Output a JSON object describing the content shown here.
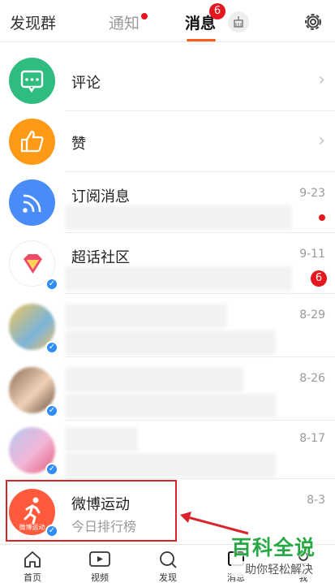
{
  "header": {
    "left_label": "发现群",
    "tab_notify": "通知",
    "tab_messages": "消息",
    "messages_badge": "6"
  },
  "rows": [
    {
      "title": "评论",
      "icon": "comment-icon",
      "color": "#2fbd7f"
    },
    {
      "title": "赞",
      "icon": "thumbs-up-icon",
      "color": "#ff9a16"
    },
    {
      "title": "订阅消息",
      "date": "9-23",
      "icon": "rss-icon",
      "color": "#4a8cf7"
    },
    {
      "title": "超话社区",
      "date": "9-11",
      "badge": "6",
      "icon": "diamond-icon"
    },
    {
      "date": "8-29"
    },
    {
      "date": "8-26"
    },
    {
      "date": "8-17"
    },
    {
      "title": "微博运动",
      "subtitle": "今日排行榜",
      "date": "8-3",
      "avatar_text": "微博运动",
      "icon": "runner-icon",
      "color": "#ff5a3c"
    }
  ],
  "bottom_nav": [
    {
      "label": "首页",
      "icon": "home-icon"
    },
    {
      "label": "视频",
      "icon": "video-icon"
    },
    {
      "label": "发现",
      "icon": "search-icon"
    },
    {
      "label": "消息",
      "icon": "message-icon"
    },
    {
      "label": "我",
      "icon": "profile-icon"
    }
  ],
  "watermark": {
    "big": "百科全说",
    "small": "助你轻松解决"
  }
}
